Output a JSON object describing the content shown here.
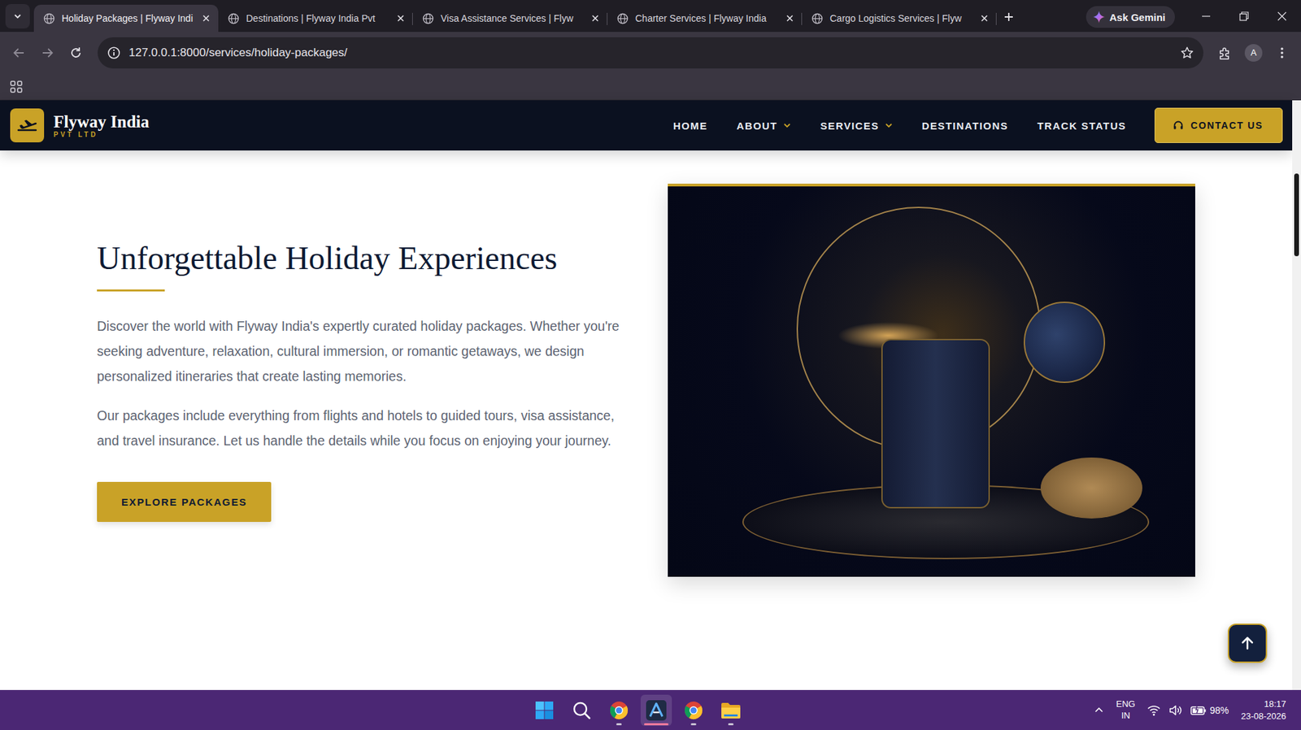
{
  "browser": {
    "tabs": [
      {
        "label": "Holiday Packages | Flyway Indi",
        "selected": true
      },
      {
        "label": "Destinations | Flyway India Pvt",
        "selected": false
      },
      {
        "label": "Visa Assistance Services | Flyw",
        "selected": false
      },
      {
        "label": "Charter Services | Flyway India",
        "selected": false
      },
      {
        "label": "Cargo Logistics Services | Flyw",
        "selected": false
      }
    ],
    "ask_gemini": "Ask Gemini",
    "address": "127.0.0.1:8000/services/holiday-packages/",
    "profile": "A"
  },
  "site": {
    "logo": {
      "name": "Flyway India",
      "sub": "PVT LTD"
    },
    "nav": [
      {
        "label": "HOME",
        "has_menu": false
      },
      {
        "label": "ABOUT",
        "has_menu": true
      },
      {
        "label": "SERVICES",
        "has_menu": true
      },
      {
        "label": "DESTINATIONS",
        "has_menu": false
      },
      {
        "label": "TRACK STATUS",
        "has_menu": false
      }
    ],
    "contact": "CONTACT US"
  },
  "hero": {
    "title": "Unforgettable Holiday Experiences",
    "paragraphs": [
      "Discover the world with Flyway India's expertly curated holiday packages. Whether you're seeking adventure, relaxation, cultural immersion, or romantic getaways, we design personalized itineraries that create lasting memories.",
      "Our packages include everything from flights and hotels to guided tours, visa assistance, and travel insurance. Let us handle the details while you focus on enjoying your journey."
    ],
    "button": "EXPLORE PACKAGES"
  },
  "taskbar": {
    "apps": [
      {
        "kind": "start",
        "running": false,
        "active": false
      },
      {
        "kind": "search",
        "running": false,
        "active": false
      },
      {
        "kind": "chrome",
        "running": true,
        "active": false
      },
      {
        "kind": "app",
        "running": true,
        "active": true
      },
      {
        "kind": "chrome",
        "running": true,
        "active": false
      },
      {
        "kind": "files",
        "running": true,
        "active": false
      }
    ],
    "lang": "ENG",
    "region": "IN",
    "battery": "98%",
    "time": "18:17",
    "date": "23-08-2026"
  }
}
